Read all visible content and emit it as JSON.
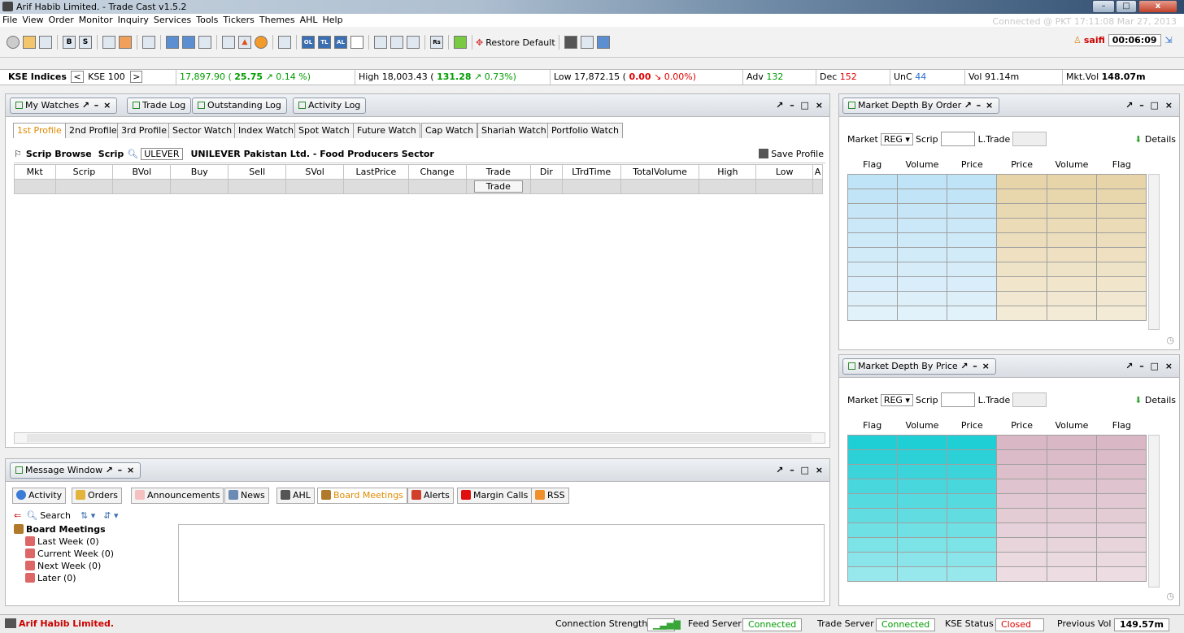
{
  "window": {
    "title": "Arif Habib Limited. - Trade Cast v1.5.2",
    "min": "–",
    "max": "□",
    "close": "x"
  },
  "menu": [
    "File",
    "View",
    "Order",
    "Monitor",
    "Inquiry",
    "Services",
    "Tools",
    "Tickers",
    "Themes",
    "AHL",
    "Help"
  ],
  "connection_text": "Connected @ PKT 17:11:08 Mar 27, 2013",
  "toolbar": {
    "restore_default": "Restore Default",
    "user": "saifi",
    "timer": "00:06:09",
    "icons": [
      "gear",
      "folder",
      "grid",
      "B",
      "S",
      "order",
      "log",
      "check",
      "layout1",
      "layout2",
      "layout3",
      "chart",
      "arrow-up",
      "pie",
      "calc",
      "OL",
      "TL",
      "AL",
      "blank",
      "copy",
      "paste",
      "docs",
      "Rs",
      "speaker",
      "move",
      "ahl",
      "tree",
      "help"
    ]
  },
  "index": {
    "label": "KSE Indices",
    "prev": "<",
    "name": "KSE 100",
    "next": ">",
    "value": "17,897.90 (",
    "change": "25.75",
    "change_pct": "0.14 %)",
    "high_label": "High 18,003.43 (",
    "high_change": "131.28",
    "high_pct": "0.73%)",
    "low_label": "Low 17,872.15 (",
    "low_change": "0.00",
    "low_pct": "0.00%)",
    "adv_label": "Adv",
    "adv": "132",
    "dec_label": "Dec",
    "dec": "152",
    "unc_label": "UnC",
    "unc": "44",
    "vol": "Vol 91.14m",
    "mktvol_label": "Mkt.Vol",
    "mktvol": "148.07m"
  },
  "watch": {
    "tabs": [
      "My Watches",
      "Trade Log",
      "Outstanding Log",
      "Activity Log"
    ],
    "profiles": [
      "1st Profile",
      "2nd Profile",
      "3rd Profile",
      "Sector Watch",
      "Index Watch",
      "Spot Watch",
      "Future Watch",
      "Cap Watch",
      "Shariah Watch",
      "Portfolio Watch"
    ],
    "scrip_browse": "Scrip Browse",
    "scrip_label": "Scrip",
    "scrip_value": "ULEVER",
    "company": "UNILEVER Pakistan Ltd. - Food Producers Sector",
    "save_profile": "Save Profile",
    "columns": [
      "Mkt",
      "Scrip",
      "BVol",
      "Buy",
      "Sell",
      "SVol",
      "LastPrice",
      "Change",
      "Trade",
      "Dir",
      "LTrdTime",
      "TotalVolume",
      "High",
      "Low",
      "A"
    ],
    "trade_button": "Trade"
  },
  "message": {
    "title": "Message Window",
    "tabs": [
      "Activity",
      "Orders",
      "Announcements",
      "News",
      "AHL",
      "Board Meetings",
      "Alerts",
      "Margin Calls",
      "RSS"
    ],
    "search": "Search",
    "tree_root": "Board Meetings",
    "tree_items": [
      "Last Week (0)",
      "Current Week (0)",
      "Next Week (0)",
      "Later (0)"
    ]
  },
  "depth_order": {
    "title": "Market Depth By Order",
    "market_label": "Market",
    "market": "REG",
    "scrip_label": "Scrip",
    "ltrade_label": "L.Trade",
    "details": "Details",
    "columns": [
      "Flag",
      "Volume",
      "Price",
      "Price",
      "Volume",
      "Flag"
    ]
  },
  "depth_price": {
    "title": "Market Depth By Price",
    "market_label": "Market",
    "market": "REG",
    "scrip_label": "Scrip",
    "ltrade_label": "L.Trade",
    "details": "Details",
    "columns": [
      "Flag",
      "Volume",
      "Price",
      "Price",
      "Volume",
      "Flag"
    ]
  },
  "status": {
    "brand": "Arif Habib Limited.",
    "conn_strength": "Connection Strength",
    "feed_label": "Feed Server",
    "feed": "Connected",
    "trade_label": "Trade Server",
    "trade": "Connected",
    "kse_label": "KSE Status",
    "kse": "Closed",
    "prev_label": "Previous Vol",
    "prev": "149.57m"
  },
  "panel_controls": "↗ – □ ×",
  "ctrl_short": "↗ – ×",
  "colors": {
    "accent_green": "#009c00",
    "alert_red": "#e00000",
    "bid_blue": "#bfe3f7",
    "ask_tan": "#e7d4a8",
    "bid_teal": "#1fcfd6",
    "ask_pink": "#d9b7c4"
  }
}
